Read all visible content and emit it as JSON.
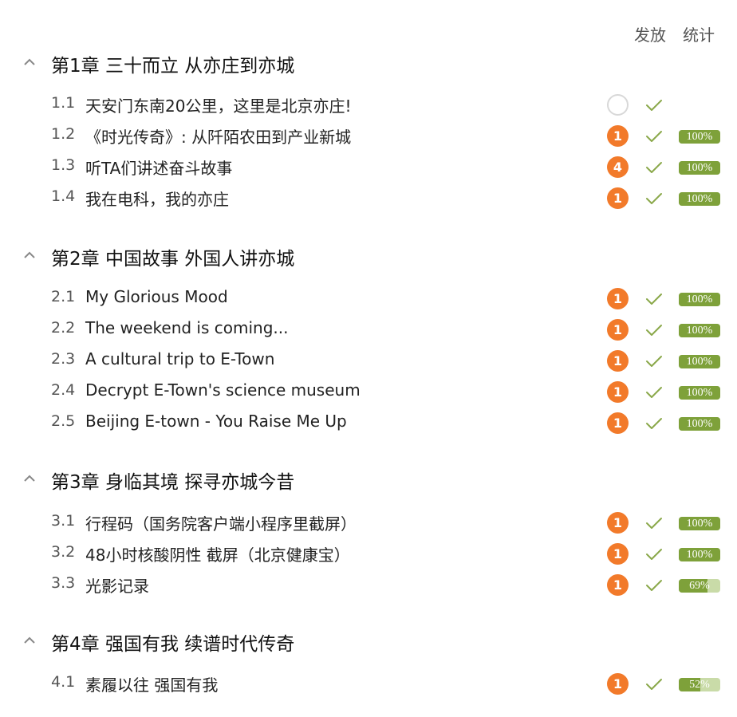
{
  "header": {
    "release_label": "发放",
    "stats_label": "统计"
  },
  "colors": {
    "badge_orange": "#f27a2a",
    "check_green": "#8aa84a",
    "progress_green": "#7ea13a",
    "progress_track": "#c9dba8"
  },
  "icons": {
    "collapse": "chevron-up-icon",
    "done": "check-icon"
  },
  "chapters": [
    {
      "title": "第1章 三十而立 从亦庄到亦城",
      "lessons": [
        {
          "num": "1.1",
          "title": "天安门东南20公里，这里是北京亦庄!",
          "count": "",
          "progress": null,
          "progress_label": ""
        },
        {
          "num": "1.2",
          "title": "《时光传奇》: 从阡陌农田到产业新城",
          "count": "1",
          "progress": 100,
          "progress_label": "100%"
        },
        {
          "num": "1.3",
          "title": "听TA们讲述奋斗故事",
          "count": "4",
          "progress": 100,
          "progress_label": "100%"
        },
        {
          "num": "1.4",
          "title": "我在电科，我的亦庄",
          "count": "1",
          "progress": 100,
          "progress_label": "100%"
        }
      ]
    },
    {
      "title": "第2章 中国故事 外国人讲亦城",
      "lessons": [
        {
          "num": "2.1",
          "title": "My Glorious Mood",
          "count": "1",
          "progress": 100,
          "progress_label": "100%"
        },
        {
          "num": "2.2",
          "title": "The weekend is coming...",
          "count": "1",
          "progress": 100,
          "progress_label": "100%"
        },
        {
          "num": "2.3",
          "title": "A cultural trip to E-Town",
          "count": "1",
          "progress": 100,
          "progress_label": "100%"
        },
        {
          "num": "2.4",
          "title": "Decrypt E-Town's science museum",
          "count": "1",
          "progress": 100,
          "progress_label": "100%"
        },
        {
          "num": "2.5",
          "title": "Beijing E-town - You Raise Me Up",
          "count": "1",
          "progress": 100,
          "progress_label": "100%"
        }
      ]
    },
    {
      "title": "第3章 身临其境 探寻亦城今昔",
      "lessons": [
        {
          "num": "3.1",
          "title": "行程码（国务院客户端小程序里截屏）",
          "count": "1",
          "progress": 100,
          "progress_label": "100%"
        },
        {
          "num": "3.2",
          "title": "48小时核酸阴性 截屏（北京健康宝）",
          "count": "1",
          "progress": 100,
          "progress_label": "100%"
        },
        {
          "num": "3.3",
          "title": "光影记录",
          "count": "1",
          "progress": 69,
          "progress_label": "69%"
        }
      ]
    },
    {
      "title": "第4章 强国有我 续谱时代传奇",
      "lessons": [
        {
          "num": "4.1",
          "title": "素履以往 强国有我",
          "count": "1",
          "progress": 52,
          "progress_label": "52%"
        }
      ]
    }
  ]
}
